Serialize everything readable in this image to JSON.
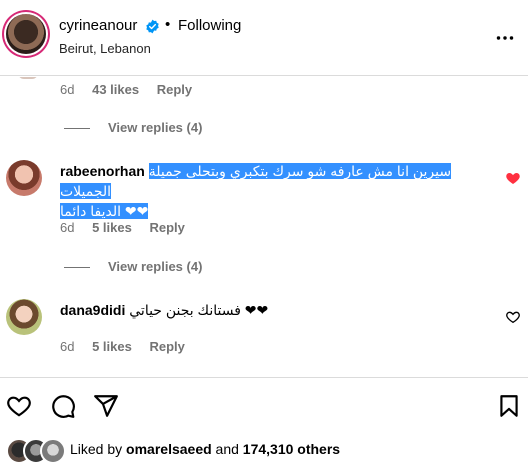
{
  "header": {
    "username": "cyrineanour",
    "separator": "•",
    "following_label": "Following",
    "location": "Beirut, Lebanon",
    "verified_color": "#0095f6",
    "ring_color": "#d62976"
  },
  "comments": {
    "top": {
      "time": "6d",
      "likes": "43 likes",
      "reply_label": "Reply",
      "view_replies": "View replies (4)"
    },
    "items": [
      {
        "username": "rabeenorhan",
        "text_line1": "سيرين انا مش عارفه شو سرك بتكبري وبتحلى جميلة الجميلات",
        "text_line2": "❤❤ الديفا دائما",
        "text_highlighted": true,
        "time": "6d",
        "likes": "5 likes",
        "reply_label": "Reply",
        "view_replies": "View replies (4)",
        "liked": true,
        "heart_color": "#ff3040"
      },
      {
        "username": "dana9didi",
        "text": "❤❤ فستانك بجنن حياتي",
        "time": "6d",
        "likes": "5 likes",
        "reply_label": "Reply",
        "liked": false
      }
    ]
  },
  "actions": {
    "icons": [
      "heart-icon",
      "comment-icon",
      "share-icon",
      "bookmark-icon"
    ]
  },
  "likes_summary": {
    "prefix": "Liked by ",
    "user": "omarelsaeed",
    "middle": " and ",
    "count": "174,310 others"
  }
}
